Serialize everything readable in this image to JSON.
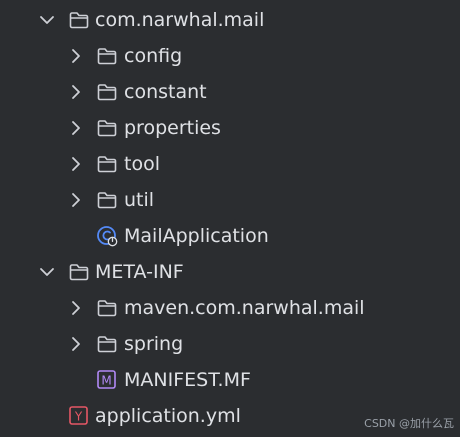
{
  "tree": {
    "root_package": {
      "label": "com.narwhal.mail",
      "expanded": true
    },
    "config": {
      "label": "config"
    },
    "constant": {
      "label": "constant"
    },
    "properties": {
      "label": "properties"
    },
    "tool": {
      "label": "tool"
    },
    "util": {
      "label": "util"
    },
    "main_class": {
      "label": "MailApplication"
    },
    "meta_inf": {
      "label": "META-INF",
      "expanded": true
    },
    "maven_dir": {
      "label": "maven.com.narwhal.mail"
    },
    "spring_dir": {
      "label": "spring"
    },
    "manifest": {
      "label": "MANIFEST.MF",
      "icon_letter": "M"
    },
    "app_yml": {
      "label": "application.yml",
      "icon_letter": "Y"
    }
  },
  "watermark": "CSDN @加什么瓦",
  "colors": {
    "background": "#2b2d30",
    "text": "#dfe1e5",
    "folder_stroke": "#ced0d6",
    "chevron": "#ced0d6",
    "class_icon": "#548af7",
    "manifest_icon": "#b189f5",
    "yaml_icon": "#e55765"
  },
  "icons": {
    "folder": "folder-icon",
    "chevron_right": "chevron-right-icon",
    "chevron_down": "chevron-down-icon",
    "spring_boot_class": "spring-boot-class-icon",
    "manifest": "manifest-icon",
    "yaml": "yaml-icon"
  }
}
